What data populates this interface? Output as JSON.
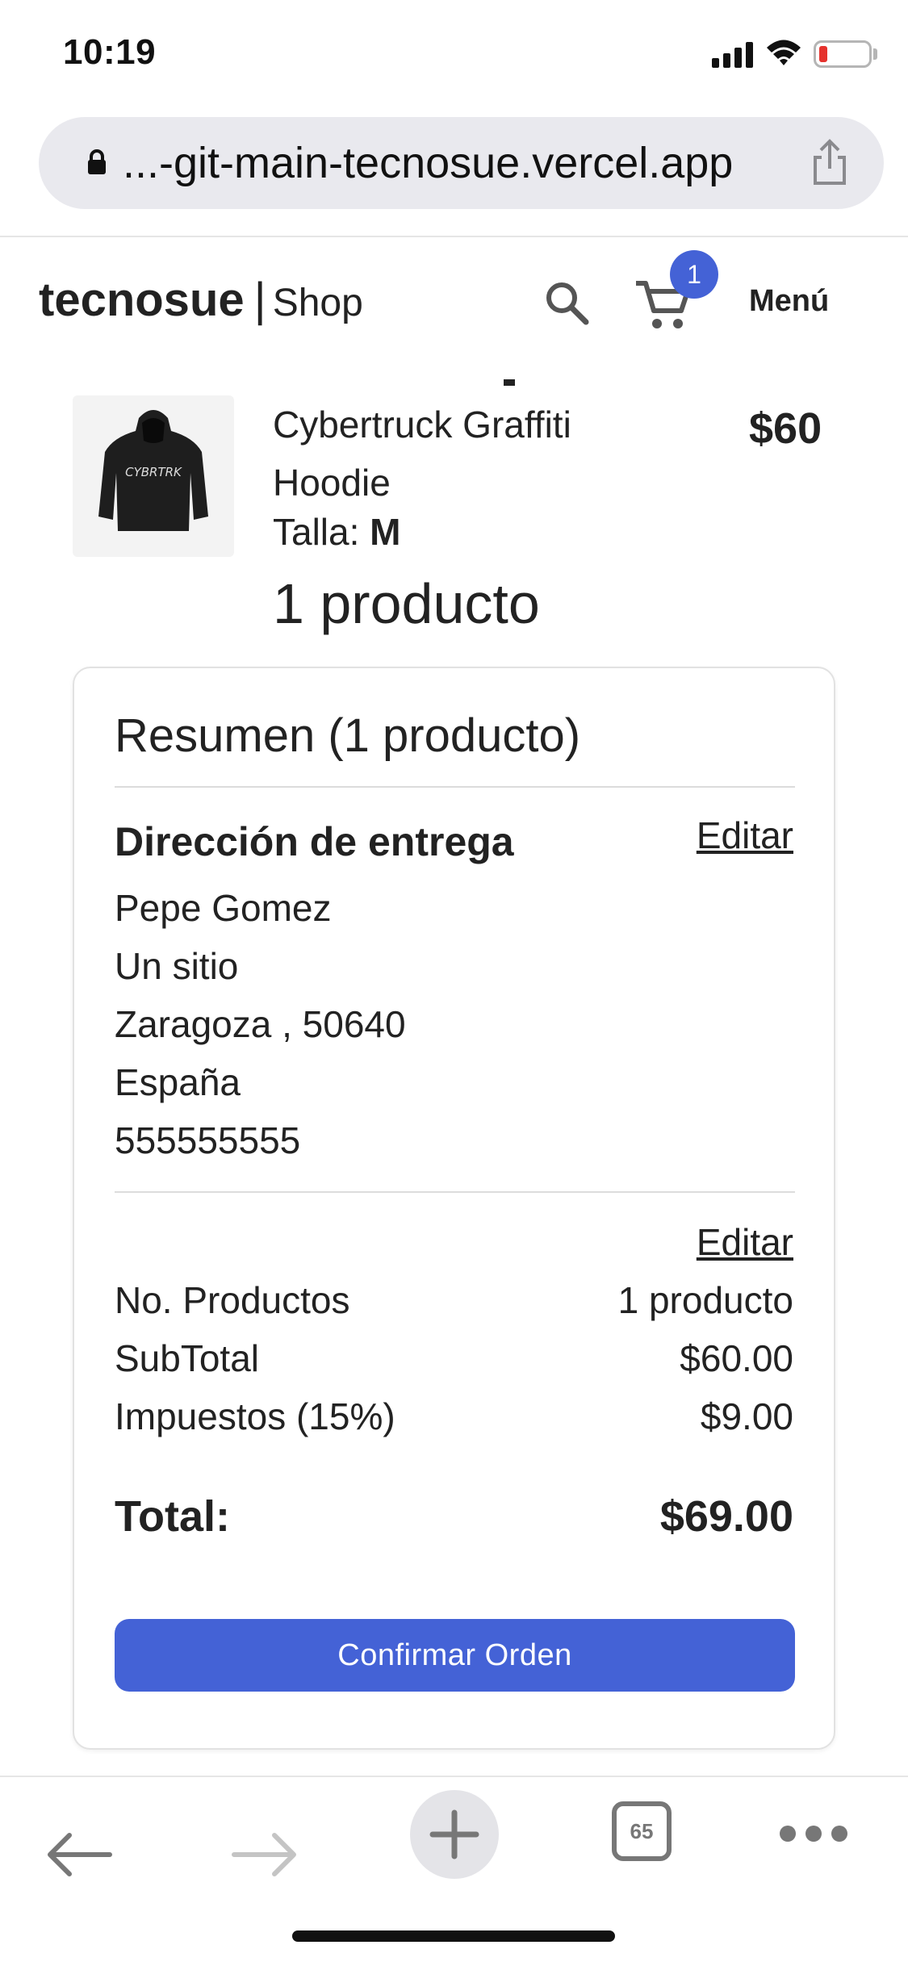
{
  "status_bar": {
    "time": "10:19"
  },
  "browser": {
    "url": "...-git-main-tecnosue.vercel.app"
  },
  "header": {
    "brand_name": "tecnosue",
    "brand_separator": "|",
    "brand_section": "Shop",
    "cart_count": "1",
    "menu_label": "Menú"
  },
  "product": {
    "name": "Cybertruck Graffiti Hoodie",
    "size_label": "Talla:",
    "size_value": "M",
    "price": "$60",
    "count_text": "1 producto",
    "image_text": "CYBRTRK"
  },
  "summary": {
    "title": "Resumen (1 producto)",
    "address_heading": "Dirección de entrega",
    "edit_label": "Editar",
    "address_lines": [
      "Pepe Gomez",
      "Un sitio",
      "Zaragoza , 50640",
      "España",
      "555555555"
    ],
    "rows": [
      {
        "label": "No. Productos",
        "value": "1 producto"
      },
      {
        "label": "SubTotal",
        "value": "$60.00"
      },
      {
        "label": "Impuestos (15%)",
        "value": "$9.00"
      }
    ],
    "total_label": "Total:",
    "total_value": "$69.00",
    "confirm_label": "Confirmar Orden"
  },
  "toolbar": {
    "tab_count": "65"
  },
  "colors": {
    "accent": "#4462d6",
    "battery_low": "#e5322d"
  },
  "icons": [
    "lock-icon",
    "share-icon",
    "search-icon",
    "cart-icon",
    "back-arrow-icon",
    "forward-arrow-icon",
    "plus-icon",
    "tabs-icon",
    "more-icon"
  ]
}
